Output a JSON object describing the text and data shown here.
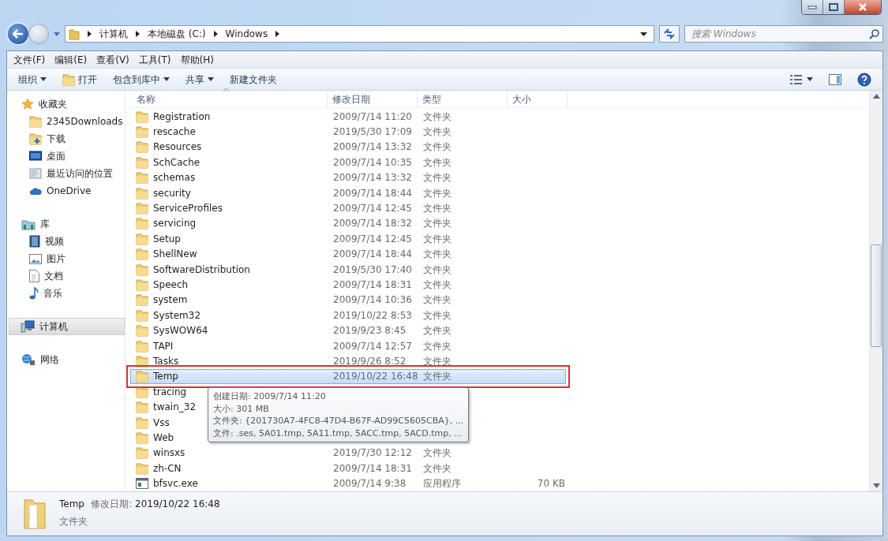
{
  "address": {
    "crumbs": [
      "计算机",
      "本地磁盘 (C:)",
      "Windows"
    ]
  },
  "search": {
    "placeholder": "搜索 Windows"
  },
  "menu": [
    "文件(F)",
    "编辑(E)",
    "查看(V)",
    "工具(T)",
    "帮助(H)"
  ],
  "toolbar": [
    {
      "label": "组织",
      "kind": "dropdown"
    },
    {
      "label": "打开",
      "kind": "open"
    },
    {
      "label": "包含到库中",
      "kind": "dropdown"
    },
    {
      "label": "共享",
      "kind": "dropdown"
    },
    {
      "label": "新建文件夹",
      "kind": "plain"
    }
  ],
  "sidebar": [
    {
      "label": "收藏夹",
      "kind": "star",
      "selected": false,
      "children": [
        {
          "label": "2345Downloads",
          "kind": "folder",
          "selected": false
        },
        {
          "label": "下载",
          "kind": "download",
          "selected": false
        },
        {
          "label": "桌面",
          "kind": "desktop",
          "selected": false
        },
        {
          "label": "最近访问的位置",
          "kind": "recent",
          "selected": false
        },
        {
          "label": "OneDrive",
          "kind": "cloud",
          "selected": false
        }
      ]
    },
    {
      "label": "库",
      "kind": "library",
      "selected": false,
      "children": [
        {
          "label": "视频",
          "kind": "video",
          "selected": false
        },
        {
          "label": "图片",
          "kind": "picture",
          "selected": false
        },
        {
          "label": "文档",
          "kind": "document",
          "selected": false
        },
        {
          "label": "音乐",
          "kind": "music",
          "selected": false
        }
      ]
    },
    {
      "label": "计算机",
      "kind": "computer",
      "selected": true
    },
    {
      "label": "网络",
      "kind": "network",
      "selected": false
    }
  ],
  "columns": [
    {
      "label": "名称",
      "sorted": true
    },
    {
      "label": "修改日期",
      "sorted": false
    },
    {
      "label": "类型",
      "sorted": false
    },
    {
      "label": "大小",
      "sorted": false
    }
  ],
  "rows": [
    {
      "name": "Registration",
      "date": "2009/7/14 11:20",
      "type": "文件夹",
      "kind": "folder",
      "selected": false,
      "highlighted": false
    },
    {
      "name": "rescache",
      "date": "2019/5/30 17:09",
      "type": "文件夹",
      "kind": "folder",
      "selected": false,
      "highlighted": false
    },
    {
      "name": "Resources",
      "date": "2009/7/14 13:32",
      "type": "文件夹",
      "kind": "folder",
      "selected": false,
      "highlighted": false
    },
    {
      "name": "SchCache",
      "date": "2009/7/14 10:35",
      "type": "文件夹",
      "kind": "folder",
      "selected": false,
      "highlighted": false
    },
    {
      "name": "schemas",
      "date": "2009/7/14 13:32",
      "type": "文件夹",
      "kind": "folder",
      "selected": false,
      "highlighted": false
    },
    {
      "name": "security",
      "date": "2009/7/14 18:44",
      "type": "文件夹",
      "kind": "folder",
      "selected": false,
      "highlighted": false
    },
    {
      "name": "ServiceProfiles",
      "date": "2009/7/14 12:45",
      "type": "文件夹",
      "kind": "folder",
      "selected": false,
      "highlighted": false
    },
    {
      "name": "servicing",
      "date": "2009/7/14 18:32",
      "type": "文件夹",
      "kind": "folder",
      "selected": false,
      "highlighted": false
    },
    {
      "name": "Setup",
      "date": "2009/7/14 12:45",
      "type": "文件夹",
      "kind": "folder",
      "selected": false,
      "highlighted": false
    },
    {
      "name": "ShellNew",
      "date": "2009/7/14 18:44",
      "type": "文件夹",
      "kind": "folder",
      "selected": false,
      "highlighted": false
    },
    {
      "name": "SoftwareDistribution",
      "date": "2019/5/30 17:40",
      "type": "文件夹",
      "kind": "folder",
      "selected": false,
      "highlighted": false
    },
    {
      "name": "Speech",
      "date": "2009/7/14 18:31",
      "type": "文件夹",
      "kind": "folder",
      "selected": false,
      "highlighted": false
    },
    {
      "name": "system",
      "date": "2009/7/14 10:36",
      "type": "文件夹",
      "kind": "folder",
      "selected": false,
      "highlighted": false
    },
    {
      "name": "System32",
      "date": "2019/10/22 8:53",
      "type": "文件夹",
      "kind": "folder",
      "selected": false,
      "highlighted": false
    },
    {
      "name": "SysWOW64",
      "date": "2019/9/23 8:45",
      "type": "文件夹",
      "kind": "folder",
      "selected": false,
      "highlighted": false
    },
    {
      "name": "TAPI",
      "date": "2009/7/14 12:57",
      "type": "文件夹",
      "kind": "folder",
      "selected": false,
      "highlighted": false
    },
    {
      "name": "Tasks",
      "date": "2019/9/26 8:52",
      "type": "文件夹",
      "kind": "folder",
      "selected": false,
      "highlighted": false
    },
    {
      "name": "Temp",
      "date": "2019/10/22 16:48",
      "type": "文件夹",
      "kind": "folder",
      "selected": true,
      "highlighted": true
    },
    {
      "name": "tracing",
      "kind": "folder",
      "selected": false,
      "highlighted": false
    },
    {
      "name": "twain_32",
      "kind": "folder",
      "selected": false,
      "highlighted": false
    },
    {
      "name": "Vss",
      "kind": "folder",
      "selected": false,
      "highlighted": false
    },
    {
      "name": "Web",
      "kind": "folder",
      "selected": false,
      "highlighted": false
    },
    {
      "name": "winsxs",
      "date": "2019/7/30 12:12",
      "type": "文件夹",
      "kind": "folder",
      "selected": false,
      "highlighted": false
    },
    {
      "name": "zh-CN",
      "date": "2009/7/14 18:31",
      "type": "文件夹",
      "kind": "folder",
      "selected": false,
      "highlighted": false
    },
    {
      "name": "bfsvc.exe",
      "date": "2009/7/14 9:38",
      "type": "应用程序",
      "size": "70 KB",
      "kind": "exe",
      "selected": false,
      "highlighted": false
    }
  ],
  "tooltip": {
    "lines": [
      "创建日期: 2009/7/14 11:20",
      "大小: 301 MB",
      "文件夹: {201730A7-4FC8-47D4-B67F-AD99C5605CBA}, ...",
      "文件: .ses, 5A01.tmp, 5A11.tmp, 5ACC.tmp, 5ACD.tmp, ..."
    ]
  },
  "details": {
    "name": "Temp",
    "meta_label": "修改日期:",
    "meta_value": "2019/10/22 16:48",
    "type": "文件夹"
  }
}
